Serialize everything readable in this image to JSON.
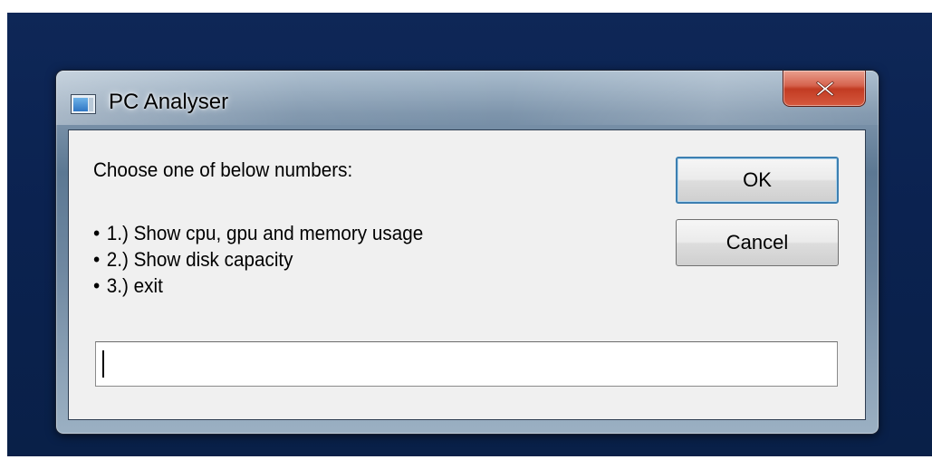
{
  "window": {
    "title": "PC Analyser",
    "icon": "application-window-icon",
    "close_icon": "close-x-icon"
  },
  "dialog": {
    "prompt": "Choose one of below numbers:",
    "options": [
      {
        "bullet": "•",
        "text": "1.) Show cpu, gpu and memory usage"
      },
      {
        "bullet": "•",
        "text": "2.) Show disk capacity"
      },
      {
        "bullet": "•",
        "text": "3.) exit"
      }
    ],
    "input_value": ""
  },
  "buttons": {
    "ok_label": "OK",
    "cancel_label": "Cancel"
  },
  "colors": {
    "desktop": "#0b2250",
    "close_button": "#c23b22",
    "client_background": "#f0f0f0",
    "default_button_border": "#3c7fb1"
  }
}
